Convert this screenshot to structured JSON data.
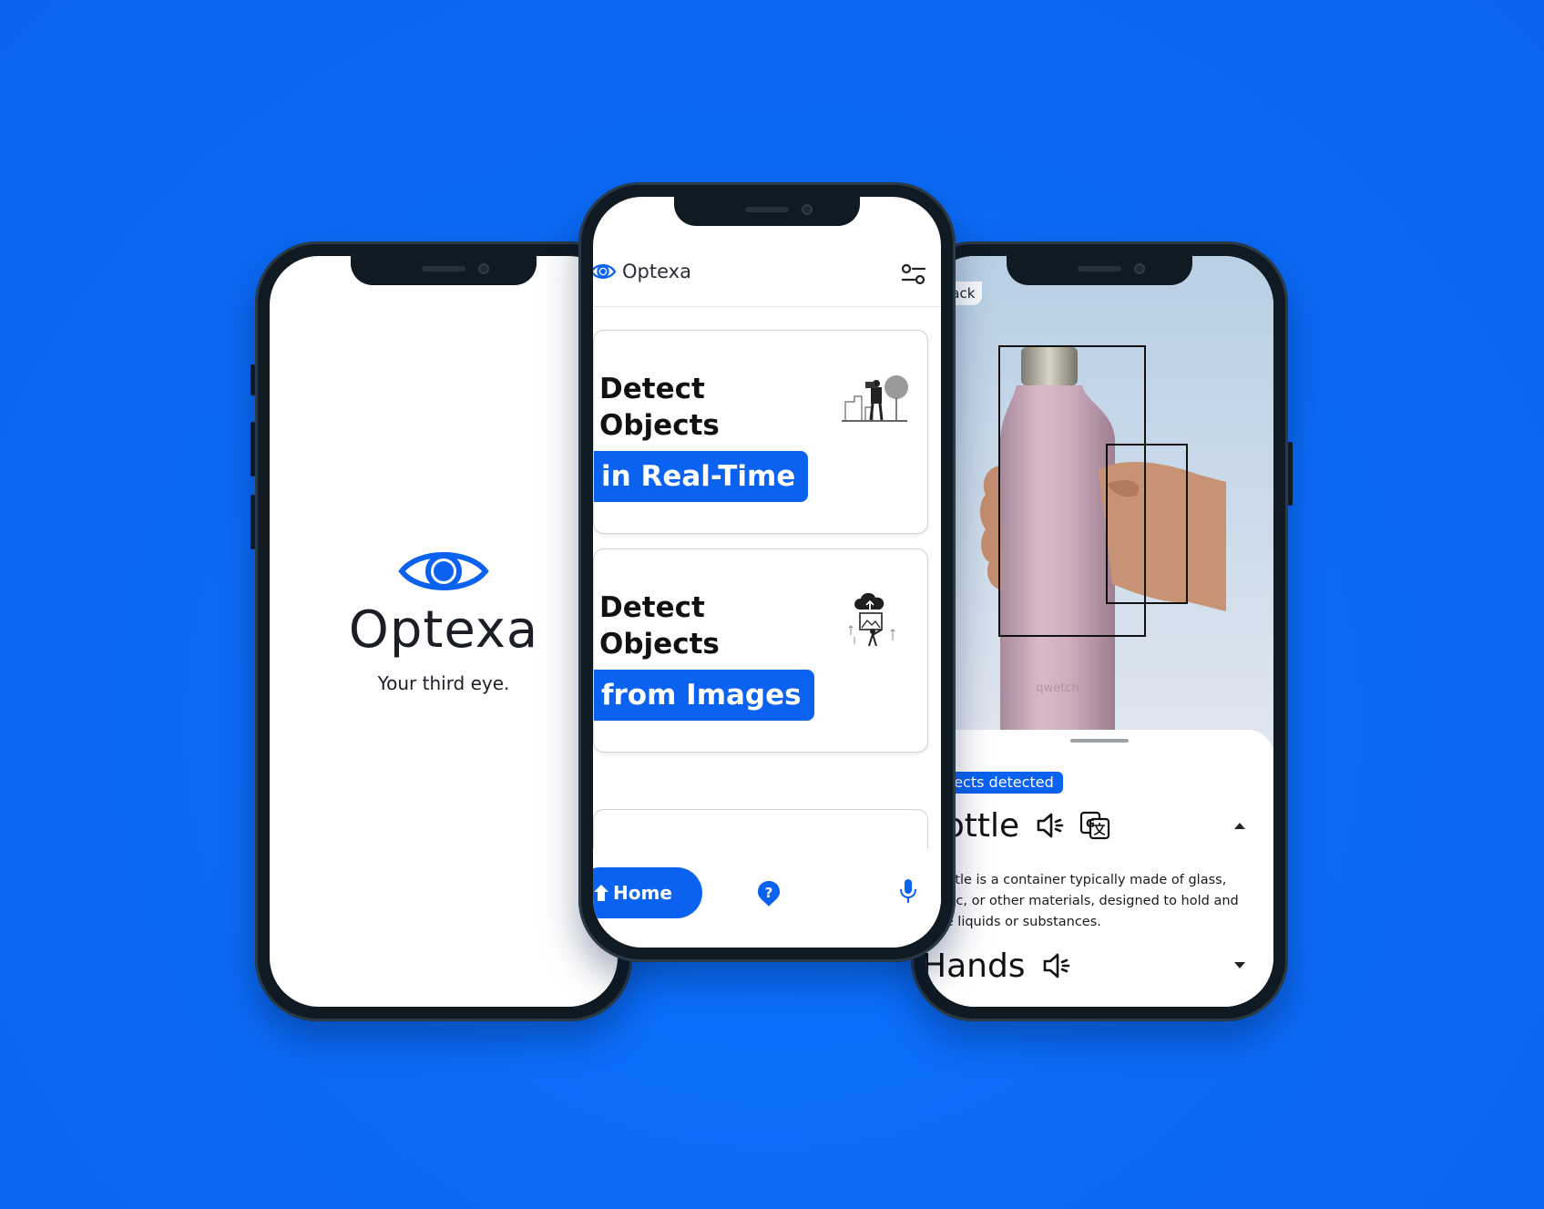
{
  "brand": {
    "name": "Optexa",
    "accent": "#0b62f0"
  },
  "splash": {
    "app_name": "Optexa",
    "tagline": "Your third eye."
  },
  "home": {
    "app_name": "Optexa",
    "cards": [
      {
        "title_line1": "Detect",
        "title_line2": "Objects",
        "pill": "in Real-Time",
        "illustration": "man-with-camera-illustration"
      },
      {
        "title_line1": "Detect",
        "title_line2": "Objects",
        "pill": "from Images",
        "illustration": "image-upload-illustration"
      }
    ],
    "nav": {
      "home_label": "Home",
      "help_icon": "help-icon",
      "mic_icon": "mic-icon"
    }
  },
  "detail": {
    "back_label": "Back",
    "chip": "Objects detected",
    "objects": [
      {
        "name": "Bottle",
        "description": "A bottle is a container typically made of glass, plastic, or other materials, designed to hold and store liquids or substances.",
        "expanded": true
      },
      {
        "name": "Hands",
        "expanded": false
      }
    ],
    "bottle_brand": "qwetch"
  }
}
